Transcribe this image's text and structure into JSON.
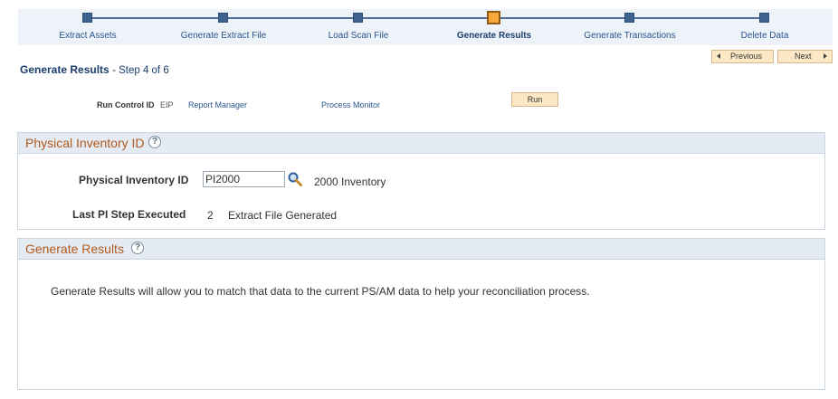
{
  "steps": [
    {
      "label": "Extract Assets",
      "active": false
    },
    {
      "label": "Generate Extract File",
      "active": false
    },
    {
      "label": "Load Scan File",
      "active": false
    },
    {
      "label": "Generate Results",
      "active": true
    },
    {
      "label": "Generate Transactions",
      "active": false
    },
    {
      "label": "Delete Data",
      "active": false
    }
  ],
  "nav": {
    "previous": "Previous",
    "next": "Next"
  },
  "page": {
    "title": "Generate Results",
    "subtitle": "- Step 4 of 6"
  },
  "run_control": {
    "label": "Run Control ID",
    "value": "EIP",
    "report_manager": "Report Manager",
    "process_monitor": "Process Monitor",
    "run_button": "Run"
  },
  "physical_inventory": {
    "section_title": "Physical Inventory ID",
    "id_label": "Physical Inventory ID",
    "id_value": "PI2000",
    "id_description": "2000 Inventory",
    "last_step_label": "Last PI Step Executed",
    "last_step_number": "2",
    "last_step_description": "Extract File Generated"
  },
  "generate_results": {
    "section_title": "Generate Results",
    "description": "Generate Results will allow you to match that data to the current PS/AM data to help your reconciliation process."
  },
  "help_glyph": "?",
  "colors": {
    "accent_orange": "#f7a93b",
    "train_blue": "#3f6391",
    "section_title": "#b2591b",
    "link": "#2a558c"
  },
  "icons": {
    "lookup": "magnifier-icon",
    "help": "question-circle-icon"
  }
}
